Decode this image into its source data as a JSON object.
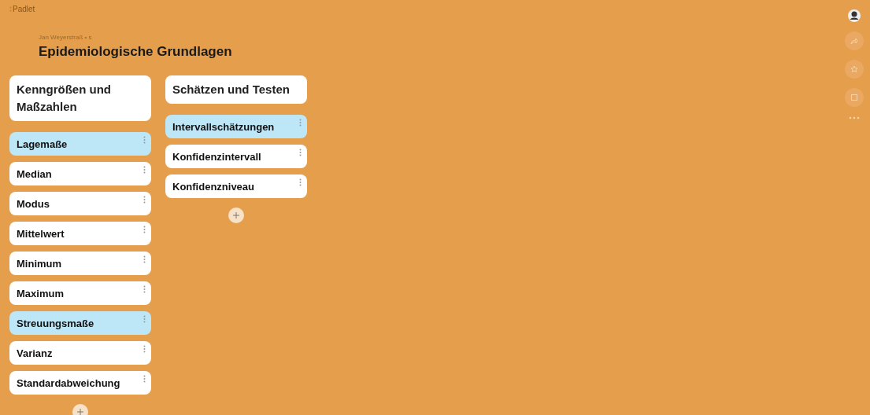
{
  "app": {
    "logo": "Padlet"
  },
  "header": {
    "breadcrumb": "Jan Weyerstraß • s",
    "title": "Epidemiologische Grundlagen"
  },
  "columns": [
    {
      "title": "Kenngrößen und Maßzahlen",
      "cards": [
        {
          "text": "Lagemaße",
          "color": "#bde6f7"
        },
        {
          "text": "Median",
          "color": "#ffffff"
        },
        {
          "text": "Modus",
          "color": "#ffffff"
        },
        {
          "text": "Mittelwert",
          "color": "#ffffff"
        },
        {
          "text": "Minimum",
          "color": "#ffffff"
        },
        {
          "text": "Maximum",
          "color": "#ffffff"
        },
        {
          "text": "Streuungsmaße",
          "color": "#bde6f7"
        },
        {
          "text": "Varianz",
          "color": "#ffffff"
        },
        {
          "text": "Standardabweichung",
          "color": "#ffffff"
        }
      ]
    },
    {
      "title": "Schätzen und Testen",
      "cards": [
        {
          "text": "Intervallschätzungen",
          "color": "#bde6f7"
        },
        {
          "text": "Konfidenzintervall",
          "color": "#ffffff"
        },
        {
          "text": "Konfidenzniveau",
          "color": "#ffffff"
        }
      ]
    }
  ]
}
